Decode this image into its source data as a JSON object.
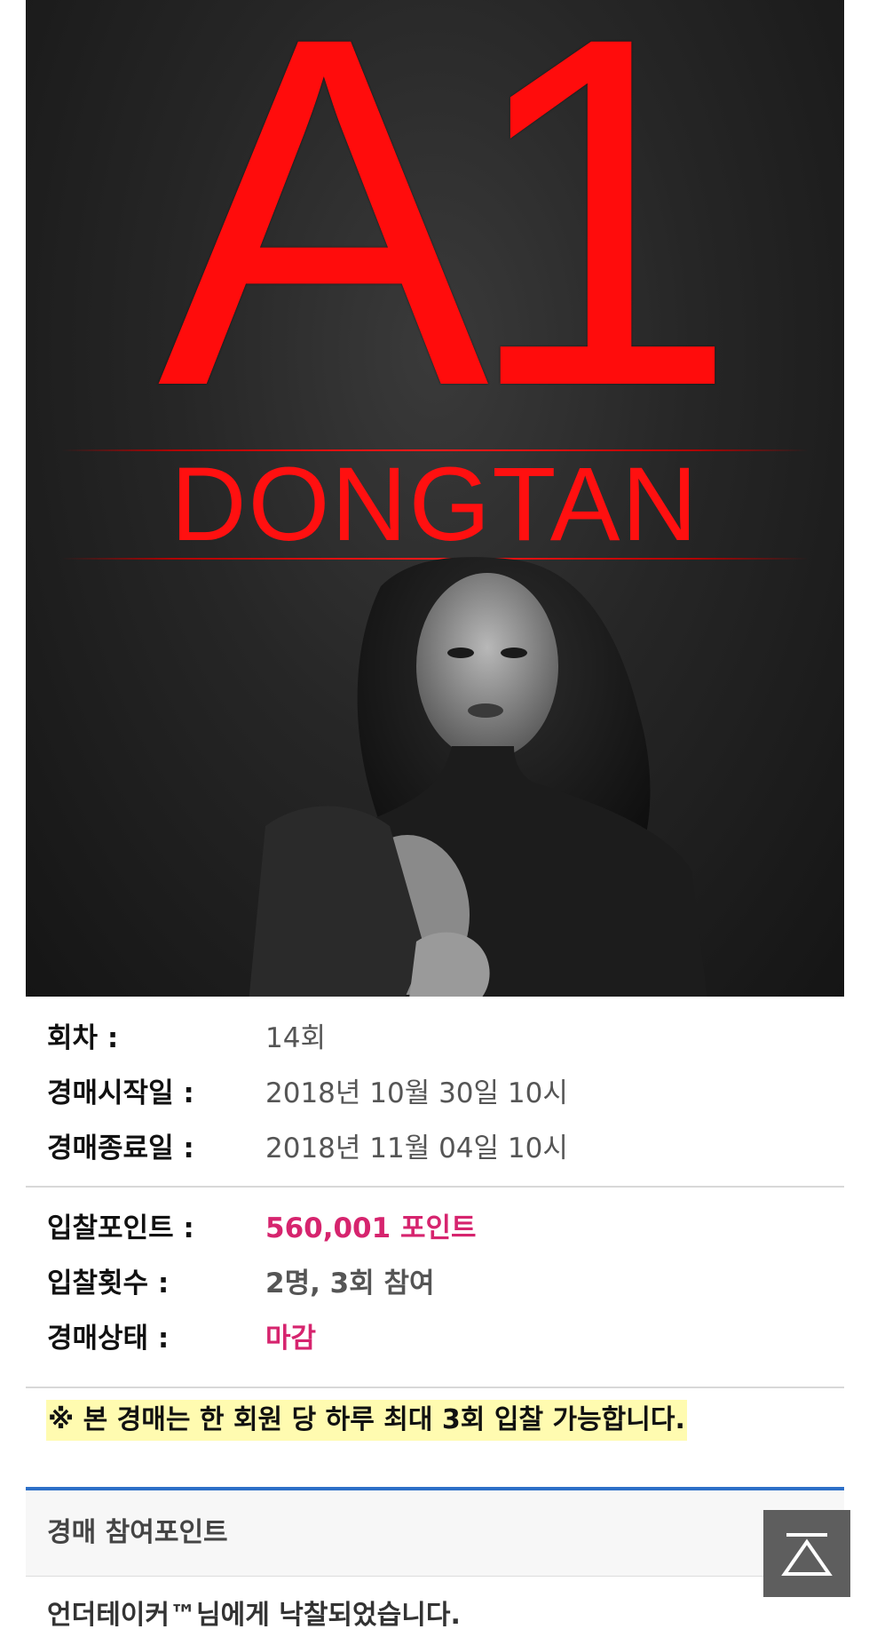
{
  "poster": {
    "logo_main": "A1",
    "logo_sub": "DONGTAN"
  },
  "details": [
    {
      "label": "회차 :",
      "value": "14회"
    },
    {
      "label": "경매시작일 :",
      "value": "2018년 10월 30일 10시"
    },
    {
      "label": "경매종료일 :",
      "value": "2018년 11월 04일 10시"
    }
  ],
  "bid": {
    "points_label": "입찰포인트 :",
    "points_value": "560,001 포인트",
    "count_label": "입찰횟수 :",
    "count_value": "2명, 3회 참여",
    "status_label": "경매상태 :",
    "status_value": "마감"
  },
  "notice": "※ 본 경매는 한 회원 당 하루 최대 3회 입찰 가능합니다.",
  "panel": {
    "header": "경매 참여포인트",
    "message": "언더테이커™님에게 낙찰되었습니다."
  },
  "scroll_top_icon": "up-triangle-icon",
  "colors": {
    "accent_pink": "#d6246e",
    "panel_border_blue": "#2d6fc7",
    "poster_red": "#ff0c0c",
    "notice_highlight": "#fffbb0"
  }
}
